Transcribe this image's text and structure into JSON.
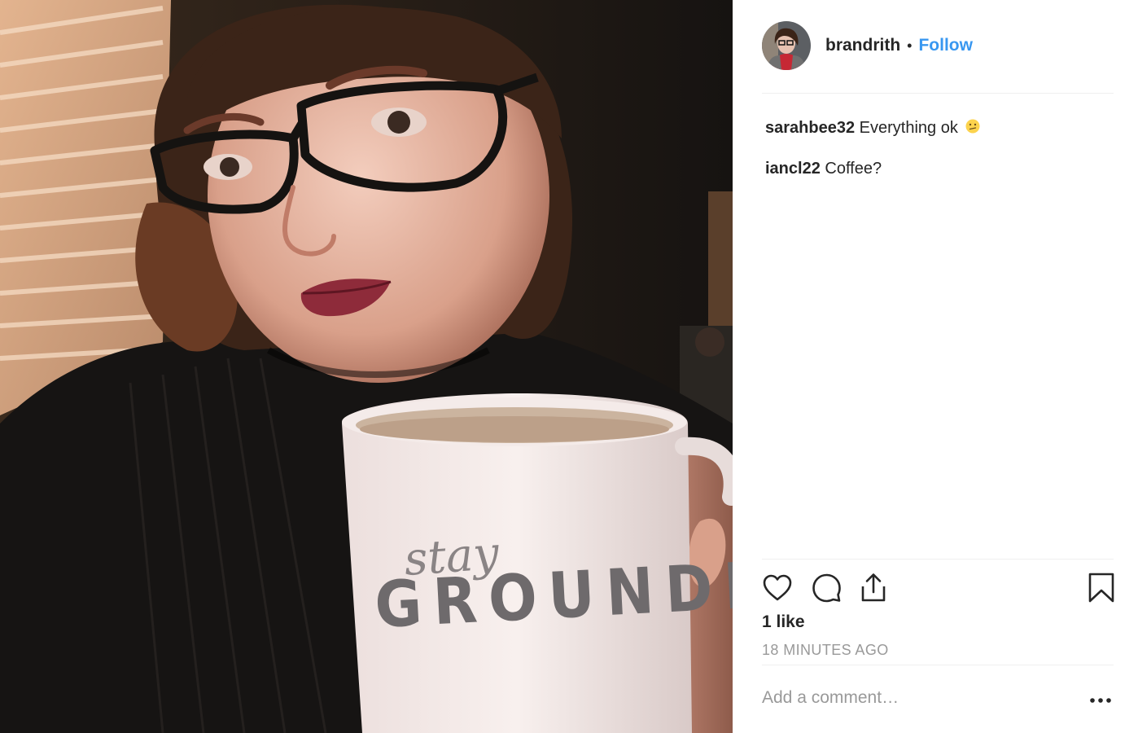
{
  "post": {
    "username": "brandrith",
    "separator": "•",
    "follow_label": "Follow",
    "comments": [
      {
        "user": "sarahbee32",
        "text": "Everything ok",
        "emoji": "confused-face-emoji"
      },
      {
        "user": "iancl22",
        "text": "Coffee?"
      }
    ],
    "likes": "1 like",
    "timestamp": "18 MINUTES AGO",
    "comment_placeholder": "Add a comment…",
    "more_label": "•••"
  },
  "photo": {
    "mug_script_text": "stay",
    "mug_text": "GROUNDED"
  },
  "icons": {
    "like": "heart-icon",
    "comment": "speech-bubble-icon",
    "share": "share-upload-icon",
    "save": "bookmark-icon",
    "more": "more-options-icon"
  },
  "colors": {
    "follow": "#3897f0",
    "text": "#262626",
    "muted": "#999999",
    "divider": "#efefef"
  }
}
